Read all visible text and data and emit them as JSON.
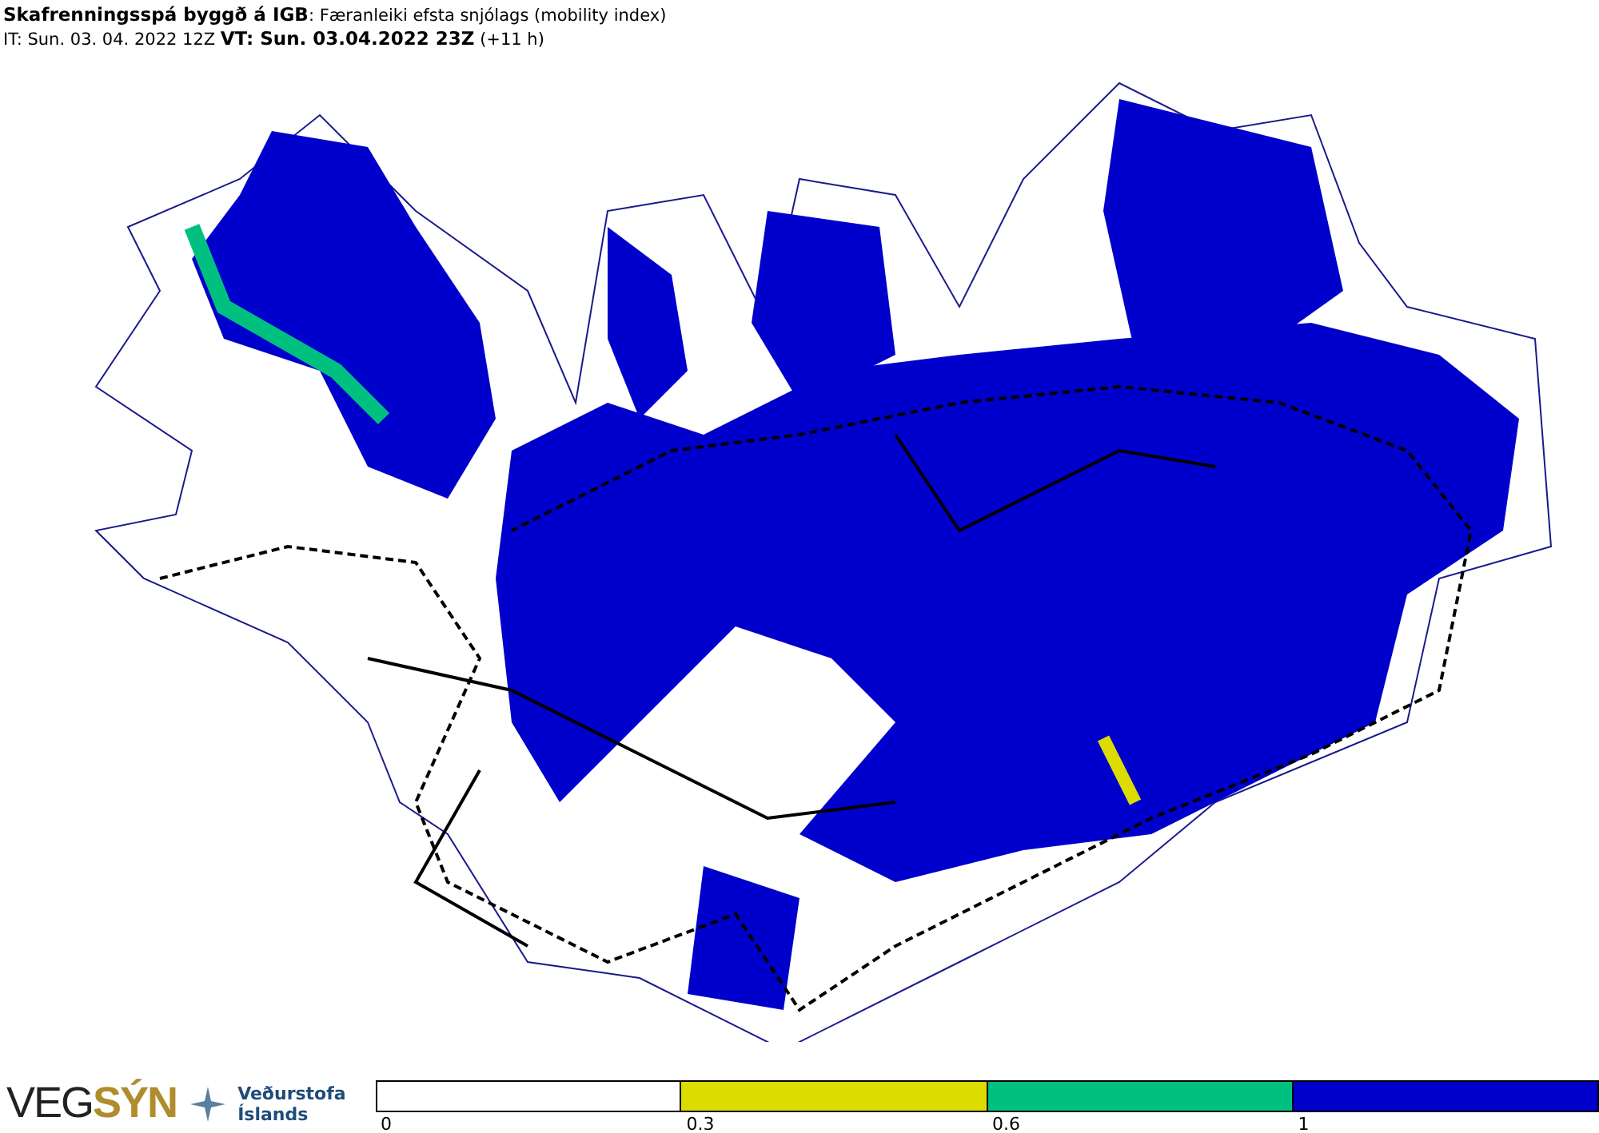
{
  "header": {
    "title": "**Skafrenningsspá byggð á IGB**: Færanleiki efsta snjólags (mobility index)",
    "times": "IT: Sun. 03. 04. 2022 12Z **VT: Sun. 03.04.2022 23Z** (+11 h)"
  },
  "logos": {
    "vegsyn": "VEG**SÝN**",
    "office_line_1": "Veðurstofa",
    "office_line_2": "Íslands"
  },
  "legend": {
    "segments": [
      {
        "color": "#ffffff",
        "label": "0"
      },
      {
        "color": "#dcdc00",
        "label": "0.3"
      },
      {
        "color": "#00c080",
        "label": "0.6"
      },
      {
        "color": "#0000cc",
        "label": "1"
      }
    ]
  }
}
